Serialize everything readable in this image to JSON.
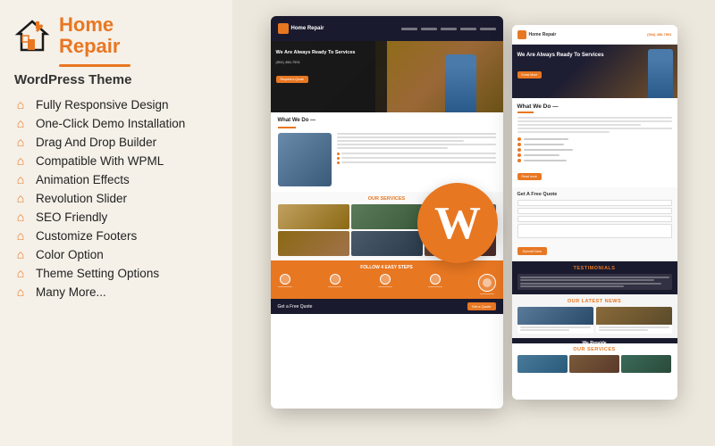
{
  "brand": {
    "name_part1": "Home",
    "name_part2": "Repair",
    "tagline": "WordPress Theme"
  },
  "features": [
    {
      "id": "fully-responsive",
      "label": "Fully Responsive Design"
    },
    {
      "id": "one-click-demo",
      "label": "One-Click Demo Installation"
    },
    {
      "id": "drag-drop",
      "label": "Drag And Drop Builder"
    },
    {
      "id": "wpml",
      "label": "Compatible With WPML"
    },
    {
      "id": "animation",
      "label": "Animation Effects"
    },
    {
      "id": "revolution-slider",
      "label": "Revolution Slider"
    },
    {
      "id": "seo",
      "label": "SEO Friendly"
    },
    {
      "id": "footers",
      "label": "Customize Footers"
    },
    {
      "id": "color",
      "label": "Color Option"
    },
    {
      "id": "theme-settings",
      "label": "Theme Setting Options"
    },
    {
      "id": "more",
      "label": "Many More..."
    }
  ],
  "mockup1": {
    "hero_title": "We Are Always Ready To Services",
    "hero_phone": "(504) 456-7591",
    "hero_btn": "Request a Quote",
    "section1_title": "What We Do —",
    "services_title": "OUR SERVICES",
    "steps_title": "FOLLOW 4 EASY STEPS",
    "quote_text": "Get a Free Quote",
    "quote_btn": "Get a Quote"
  },
  "mockup2": {
    "hero_title": "We Are Always Ready To Services",
    "phone": "(504) 456-7591",
    "hero_btn": "Know More",
    "what_we_do": "What We Do —",
    "testimonials_title": "TESTIMONIALS",
    "latest_title": "OUR LATEST NEWS",
    "services_title": "OUR SERVICES",
    "quote_title": "Get A Free Quote",
    "quote_btn": "Submit Now"
  },
  "colors": {
    "orange": "#e87722",
    "dark": "#1a1a2e",
    "bg": "#f5f0e8"
  }
}
